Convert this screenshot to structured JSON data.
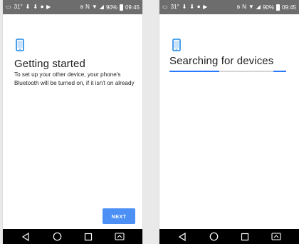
{
  "status_bar": {
    "temp": "31°",
    "battery": "90%",
    "time": "09:45"
  },
  "screen_left": {
    "title": "Getting started",
    "description": "To set up your other device, your phone's Bluetooth will be turned on, if it isn't on already",
    "next_label": "NEXT"
  },
  "screen_right": {
    "title": "Searching for devices",
    "progress_fraction": 0.5
  },
  "colors": {
    "accent": "#1e88e5",
    "button": "#4c8ff5",
    "status_bar": "#6d6d6d",
    "nav_bar": "#000000"
  },
  "icons": {
    "device": "smartphone-icon",
    "back": "back-triangle-icon",
    "home": "home-circle-icon",
    "recents": "recents-square-icon",
    "extra": "screen-cast-icon"
  }
}
